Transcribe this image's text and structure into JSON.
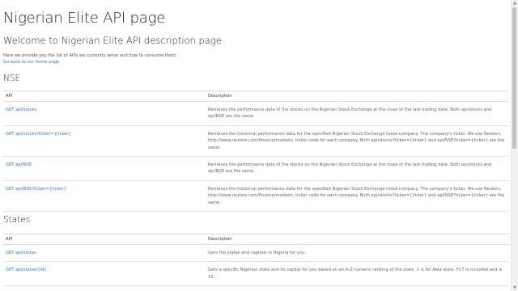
{
  "page": {
    "title": "Nigerian Elite API page",
    "welcome": "Welcome to Nigerian Elite API description page",
    "intro": "Here we provide you the list of APIs we currently serve and how to consume them.",
    "home_link": "Go back to our home page"
  },
  "sections": [
    {
      "name": "NSE",
      "headers": {
        "api": "API",
        "description": "Description"
      },
      "rows": [
        {
          "api": "GET api/stocks",
          "description": "Retrieves the performance data of the stocks on the Nigerian Stock Exchange at the close of the last trading date. Both api/stocks and api/NSE are the same."
        },
        {
          "api": "GET api/stocks?ticker={ticker}",
          "description": "Retrieves the historical performance data for the specified Nigerian Stock Exchange listed company. The company's ticker. We use Reuters, http://www.reuters.com/finance/markets, ticker code for each company. Both api/stocks?ticker={ticker} and api/NSE?ticker={ticker} are the same."
        },
        {
          "api": "GET api/NSE",
          "description": "Retrieves the performance data of the stocks on the Nigerian Stock Exchange at the close of the last trading date. Both api/stocks and api/NSE are the same."
        },
        {
          "api": "GET api/NSE?ticker={ticker}",
          "description": "Retrieves the historical performance data for the specified Nigerian Stock Exchange listed company. The company's ticker. We use Reuters, http://www.reuters.com/finance/markets, ticker code for each company. Both api/stocks?ticker={ticker} and api/NSE?ticker={ticker} are the same."
        }
      ]
    },
    {
      "name": "States",
      "headers": {
        "api": "API",
        "description": "Description"
      },
      "rows": [
        {
          "api": "GET api/states",
          "description": "Gets the states and capitals in Nigeria for you."
        },
        {
          "api": "GET api/states/{id}",
          "description": "Gets a specific Nigerian state and its capital for you based on an A-Z numeric ranking of the state. 1 is for Abia state. FCT is included and is 15."
        }
      ]
    }
  ],
  "scrollbar": {
    "up_icon": "triangle-up-icon",
    "down_icon": "triangle-down-icon"
  }
}
